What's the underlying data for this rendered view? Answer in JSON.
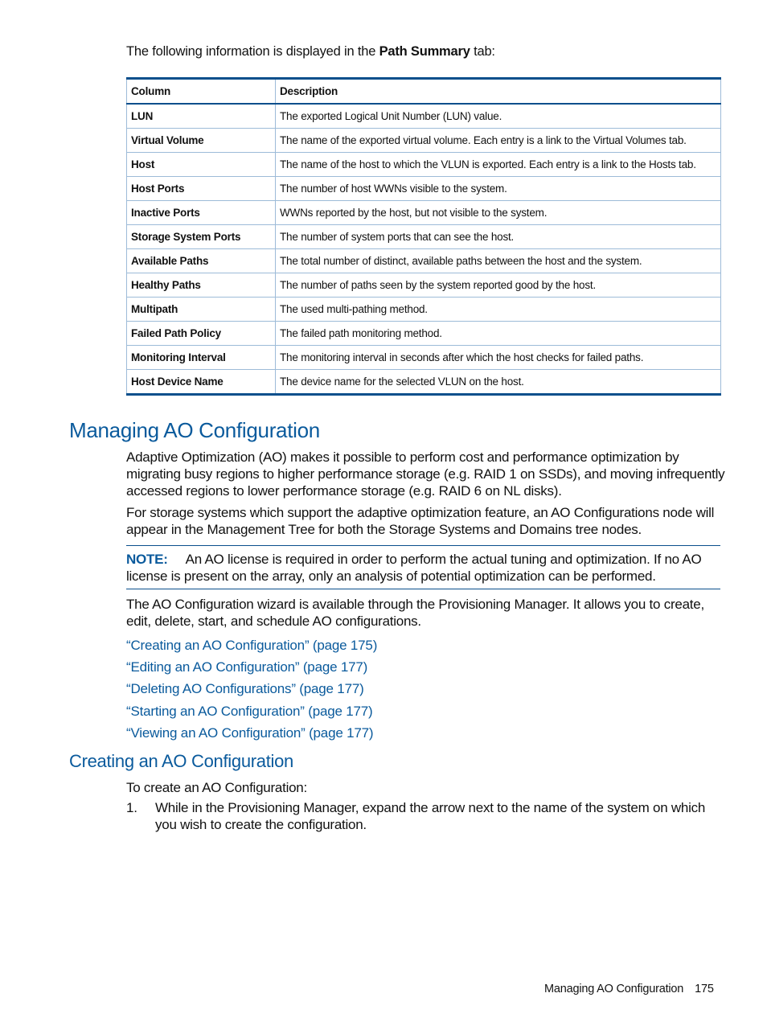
{
  "intro": {
    "prefix": "The following information is displayed in the ",
    "bold": "Path Summary",
    "suffix": " tab:"
  },
  "table": {
    "headers": [
      "Column",
      "Description"
    ],
    "rows": [
      {
        "column": "LUN",
        "description": "The exported Logical Unit Number (LUN) value."
      },
      {
        "column": "Virtual Volume",
        "description": "The name of the exported virtual volume. Each entry is a link to the Virtual Volumes tab."
      },
      {
        "column": "Host",
        "description": "The name of the host to which the VLUN is exported. Each entry is a link to the Hosts tab."
      },
      {
        "column": "Host Ports",
        "description": "The number of host WWNs visible to the system."
      },
      {
        "column": "Inactive Ports",
        "description": "WWNs reported by the host, but not visible to the system."
      },
      {
        "column": "Storage System Ports",
        "description": "The number of system ports that can see the host."
      },
      {
        "column": "Available Paths",
        "description": "The total number of distinct, available paths between the host and the system."
      },
      {
        "column": "Healthy Paths",
        "description": "The number of paths seen by the system reported good by the host."
      },
      {
        "column": "Multipath",
        "description": "The used multi-pathing method."
      },
      {
        "column": "Failed Path Policy",
        "description": "The failed path monitoring method."
      },
      {
        "column": "Monitoring Interval",
        "description": "The monitoring interval in seconds after which the host checks for failed paths."
      },
      {
        "column": "Host Device Name",
        "description": "The device name for the selected VLUN on the host."
      }
    ]
  },
  "section": {
    "title": "Managing AO Configuration",
    "para1": "Adaptive Optimization (AO) makes it possible to perform cost and performance optimization by migrating busy regions to higher performance storage (e.g. RAID 1 on SSDs), and moving infrequently accessed regions to lower performance storage (e.g. RAID 6 on NL disks).",
    "para2": "For storage systems which support the adaptive optimization feature, an AO Configurations node will appear in the Management Tree for both the Storage Systems and Domains tree nodes.",
    "note": {
      "label": "NOTE:",
      "text": "An AO license is required in order to perform the actual tuning and optimization. If no AO license is present on the array, only an analysis of potential optimization can be performed."
    },
    "para3": "The AO Configuration wizard is available through the Provisioning Manager. It allows you to create, edit, delete, start, and schedule AO configurations.",
    "links": [
      "“Creating an AO Configuration” (page 175)",
      "“Editing an AO Configuration” (page 177)",
      "“Deleting AO Configurations” (page 177)",
      "“Starting an AO Configuration” (page 177)",
      "“Viewing an AO Configuration” (page 177)"
    ]
  },
  "subsection": {
    "title": "Creating an AO Configuration",
    "intro": "To create an AO Configuration:",
    "steps": [
      {
        "num": "1.",
        "text": "While in the Provisioning Manager, expand the arrow next to the name of the system on which you wish to create the configuration."
      }
    ]
  },
  "footer": {
    "section_name": "Managing AO Configuration",
    "page_number": "175"
  }
}
